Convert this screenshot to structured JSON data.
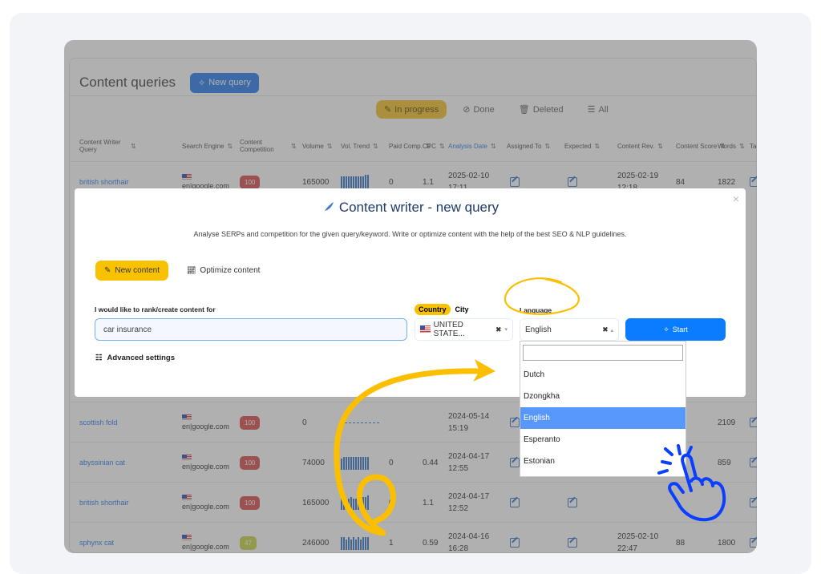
{
  "page": {
    "title": "Content queries",
    "new_query_label": "New query"
  },
  "filters": [
    {
      "label": "In progress",
      "icon": "pencil-icon",
      "active": true
    },
    {
      "label": "Done",
      "icon": "check-circle-icon",
      "active": false
    },
    {
      "label": "Deleted",
      "icon": "trash-icon",
      "active": false
    },
    {
      "label": "All",
      "icon": "list-icon",
      "active": false
    }
  ],
  "table": {
    "columns": [
      "Content Writer Query",
      "Search Engine",
      "Content Competition",
      "Volume",
      "Vol. Trend",
      "Paid Comp.",
      "CPC",
      "Analysis Date",
      "Assigned To",
      "Expected",
      "Content Rev.",
      "Content Score",
      "Words",
      "Tags"
    ],
    "sort_glyph": "⇅",
    "rows": [
      {
        "query": "british shorthair",
        "engine": "en|google.com",
        "competition": "100",
        "comp_level": "high",
        "volume": "165000",
        "trend": [
          9,
          9,
          9,
          9,
          9,
          9,
          9,
          9,
          9,
          9,
          10,
          10
        ],
        "paid_comp": "0",
        "cpc": "1.1",
        "date": "2025-02-10",
        "time": "17:11",
        "rev_date": "2025-02-19",
        "rev_time": "12:18",
        "score": "84",
        "words": "1822"
      },
      {
        "query": "scottish fold",
        "engine": "en|google.com",
        "competition": "100",
        "comp_level": "high",
        "volume": "0",
        "trend": [],
        "paid_comp": "",
        "cpc": "",
        "date": "2024-05-14",
        "time": "15:19",
        "rev_date": "",
        "rev_time": "",
        "score": "",
        "words": "2109"
      },
      {
        "query": "abyssinian cat",
        "engine": "en|google.com",
        "competition": "100",
        "comp_level": "high",
        "volume": "74000",
        "trend": [
          8,
          9,
          9,
          9,
          9,
          9,
          9,
          9,
          9,
          9,
          9,
          9
        ],
        "paid_comp": "0",
        "cpc": "0.44",
        "date": "2024-04-17",
        "time": "12:55",
        "rev_date": "",
        "rev_time": "",
        "score": "",
        "words": "859"
      },
      {
        "query": "british shorthair",
        "engine": "en|google.com",
        "competition": "100",
        "comp_level": "high",
        "volume": "165000",
        "trend": [
          10,
          8,
          8,
          8,
          9,
          8,
          8,
          9,
          9,
          9,
          9,
          10
        ],
        "paid_comp": "0",
        "cpc": "1.1",
        "date": "2024-04-17",
        "time": "12:52",
        "rev_date": "",
        "rev_time": "",
        "score": "",
        "words": ""
      },
      {
        "query": "sphynx cat",
        "engine": "en|google.com",
        "competition": "47",
        "comp_level": "medium",
        "volume": "246000",
        "trend": [
          9,
          9,
          7,
          9,
          7,
          9,
          7,
          9,
          7,
          9,
          9,
          9
        ],
        "paid_comp": "1",
        "cpc": "0.59",
        "date": "2024-04-16",
        "time": "16:28",
        "rev_date": "2025-02-10",
        "rev_time": "22:47",
        "score": "88",
        "words": "1800"
      }
    ]
  },
  "modal": {
    "title": "Content writer - new query",
    "subtitle": "Analyse SERPs and competition for the given query/keyword. Write or optimize content with the help of the best SEO & NLP guidelines.",
    "close": "×",
    "tabs": [
      {
        "label": "New content",
        "active": true
      },
      {
        "label": "Optimize content",
        "active": false
      }
    ],
    "keyword_label": "I would like to rank/create content for",
    "keyword_value": "car insurance",
    "country_label": "Country",
    "city_label": "City",
    "country_value": "UNITED STATE...",
    "language_label": "Language",
    "language_value": "English",
    "start_label": "Start",
    "advanced_label": "Advanced settings"
  },
  "language_dropdown": {
    "search_value": "",
    "options": [
      "Dutch",
      "Dzongkha",
      "English",
      "Esperanto",
      "Estonian"
    ],
    "selected": "English"
  },
  "colors": {
    "accent_blue": "#0a7cff",
    "accent_yellow": "#f8c200",
    "annotation_yellow": "#fbbf00",
    "annotation_blue": "#0b3fff",
    "badge_high": "#d9534f",
    "badge_medium": "#c9d34a"
  }
}
